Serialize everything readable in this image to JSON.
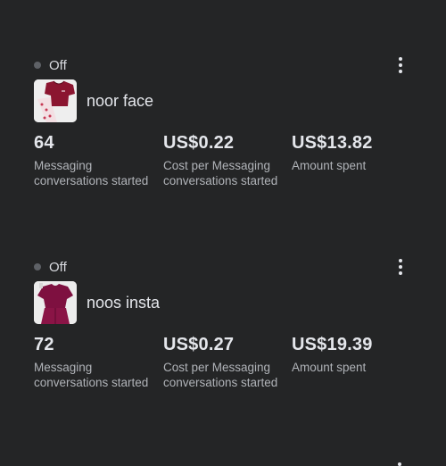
{
  "cards": [
    {
      "status": "Off",
      "title": "noor face",
      "metrics": [
        {
          "value": "64",
          "label": "Messaging conversations started"
        },
        {
          "value": "US$0.22",
          "label": "Cost per Messaging conversations started"
        },
        {
          "value": "US$13.82",
          "label": "Amount spent"
        }
      ]
    },
    {
      "status": "Off",
      "title": "noos insta",
      "metrics": [
        {
          "value": "72",
          "label": "Messaging conversations started"
        },
        {
          "value": "US$0.27",
          "label": "Cost per Messaging conversations started"
        },
        {
          "value": "US$19.39",
          "label": "Amount spent"
        }
      ]
    }
  ],
  "colors": {
    "background": "#242526",
    "text": "#e4e6eb",
    "muted": "#b0b3b8",
    "status_dot": "#5e6166",
    "product_red": "#8b1530"
  },
  "icons": {
    "status": "status-dot-icon",
    "menu": "more-vertical-icon"
  }
}
